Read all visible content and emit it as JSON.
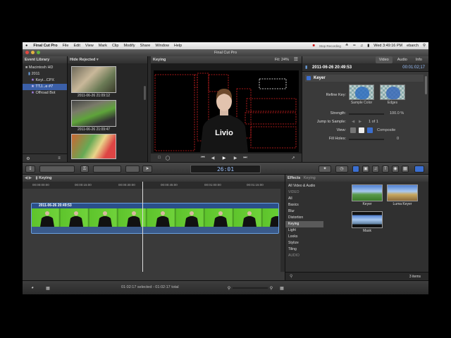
{
  "menubar": {
    "apple": "",
    "app": "Final Cut Pro",
    "items": [
      "File",
      "Edit",
      "View",
      "Mark",
      "Clip",
      "Modify",
      "Share",
      "Window",
      "Help"
    ],
    "recording": "Stop Recording",
    "clock": "Wed 3:49:16 PM",
    "user": "ebarch"
  },
  "window": {
    "title": "Final Cut Pro"
  },
  "library": {
    "header": "Event Library",
    "items": [
      "Macintosh HD",
      "2011",
      "Keyi...CPX",
      "TTJ...e #7",
      "Offroad Bot"
    ]
  },
  "browser": {
    "filter": "Hide Rejected",
    "clips": [
      "2011-06-26 21:09:12",
      "2011-06-26 21:09:47",
      ""
    ],
    "count": "1 of 24 s...",
    "duration": "All"
  },
  "viewer": {
    "title": "Keying",
    "fit_label": "Fit:",
    "fit_value": "24%",
    "shirt_text": "Livio"
  },
  "inspector": {
    "tabs": [
      "Video",
      "Audio",
      "Info"
    ],
    "clip_name": "2011-06-26 20:49:53",
    "clip_time": "00:01:02;17",
    "effect": "Keyer",
    "refine_key": "Refine Key:",
    "sample_color": "Sample Color",
    "edges": "Edges",
    "strength_label": "Strength:",
    "strength_value": "100.0 %",
    "jump_label": "Jump to Sample:",
    "jump_value": "1 of 1",
    "view_label": "View:",
    "view_value": "Composite",
    "fill_label": "Fill Holes:",
    "fill_value": "0"
  },
  "toolbar": {
    "timecode": "26:01"
  },
  "timeline": {
    "project": "Keying",
    "ruler": [
      "00:00:00:00",
      "00:00:15:00",
      "00:00:30:00",
      "00:00:45:00",
      "00:01:00:00",
      "00:01:15:00"
    ],
    "clip_title": "2011-06-26 20:49:53"
  },
  "effects": {
    "header": "Effects",
    "breadcrumb": "Keying",
    "categories": [
      "All Video & Audio",
      "VIDEO",
      "All",
      "Basics",
      "Blur",
      "Distortion",
      "Keying",
      "Light",
      "Looks",
      "Stylize",
      "Tiling",
      "AUDIO"
    ],
    "items": [
      "Keyer",
      "Luma Keyer",
      "Mask"
    ],
    "count": "3 items"
  },
  "status": {
    "text": "01:02:17 selected - 01:02:17 total"
  }
}
